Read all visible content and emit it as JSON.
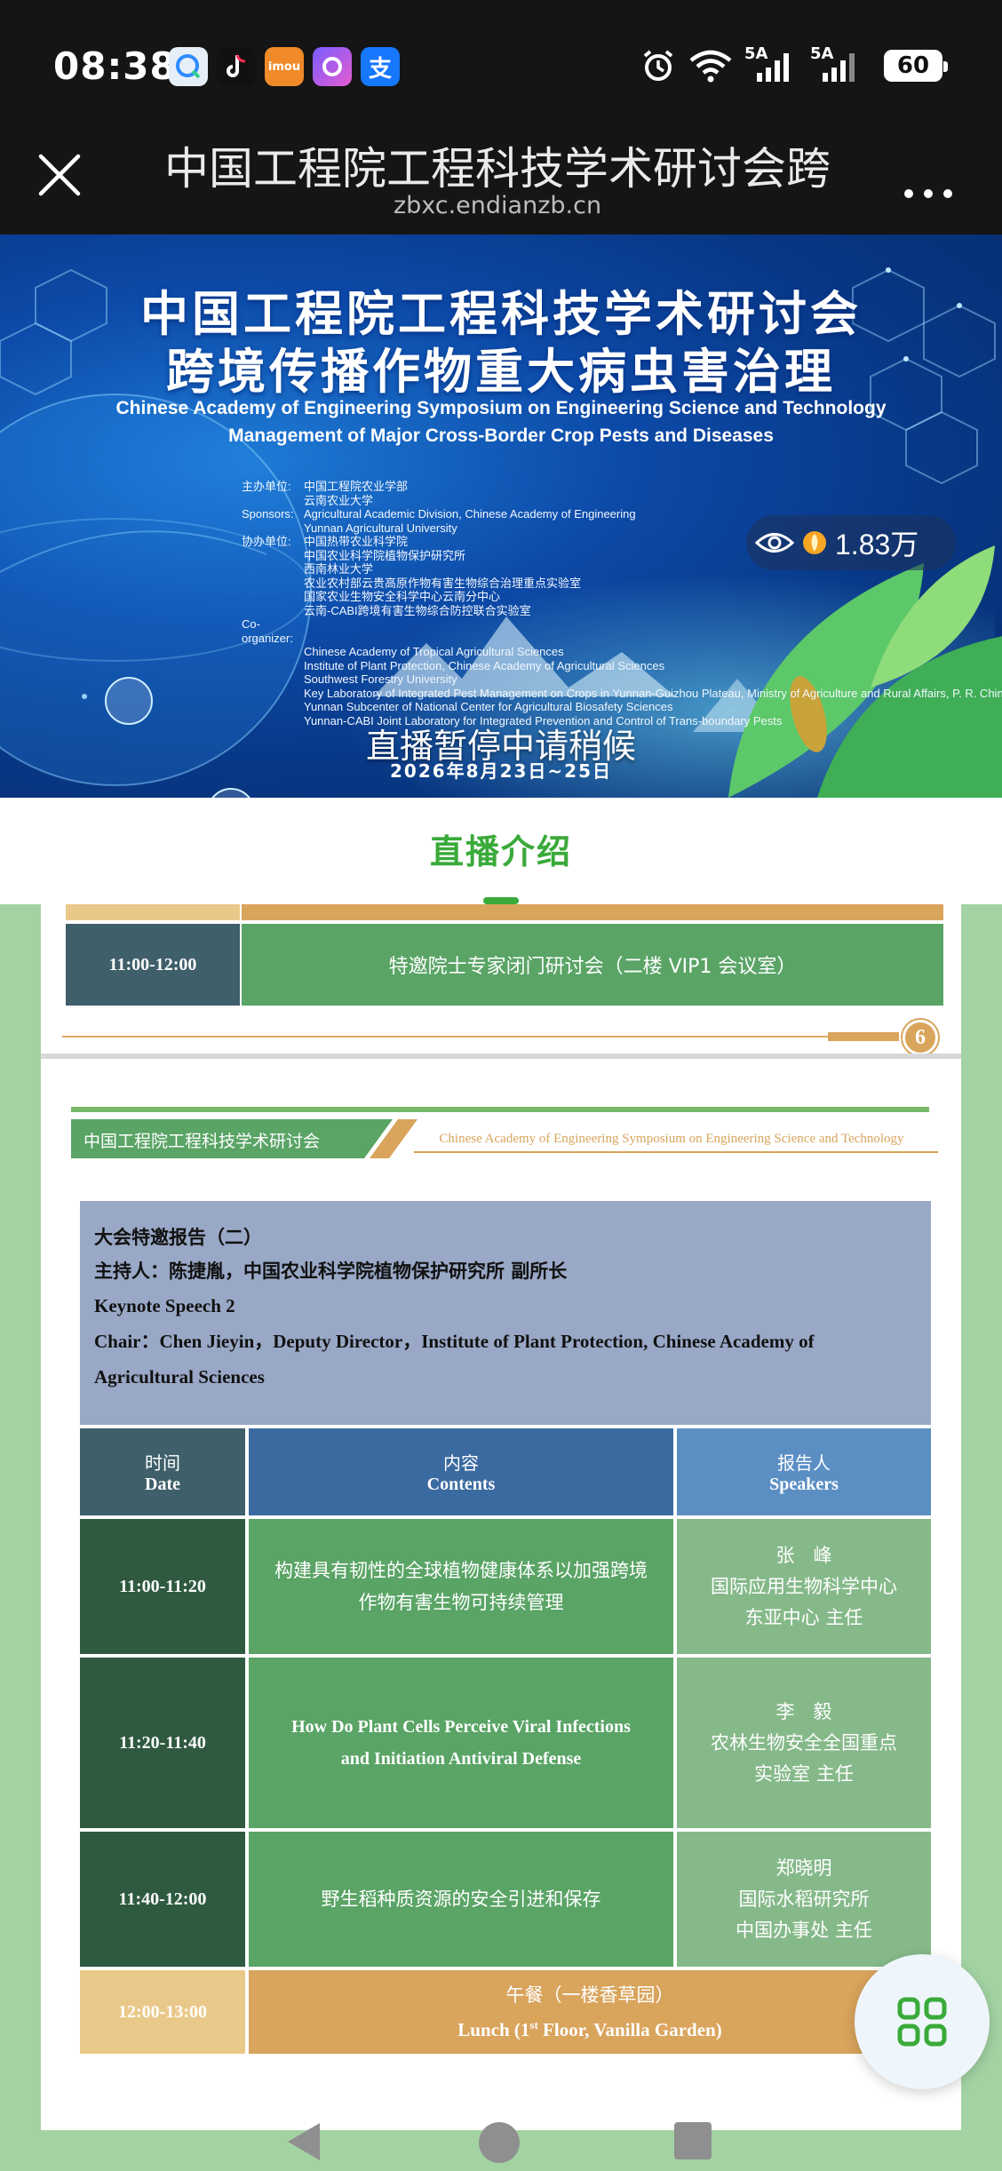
{
  "status_bar": {
    "time": "08:38",
    "app_icons": [
      {
        "name": "qq-browser-icon",
        "color": "#e6eef8"
      },
      {
        "name": "tiktok-icon",
        "color": "#111111"
      },
      {
        "name": "imou-icon",
        "label": "imou",
        "color": "#f08a2a"
      },
      {
        "name": "cloud-app-icon",
        "color": "#a96df0"
      },
      {
        "name": "alipay-icon",
        "label": "支",
        "color": "#1677ff"
      }
    ],
    "signal_1": "5A",
    "signal_2": "5A",
    "battery": "60"
  },
  "title_bar": {
    "title": "中国工程院工程科技学术研讨会跨",
    "domain": "zbxc.endianzb.cn"
  },
  "banner": {
    "title_line1": "中国工程院工程科技学术研讨会",
    "title_line2": "跨境传播作物重大病虫害治理",
    "subtitle_en_1": "Chinese Academy of Engineering Symposium on Engineering Science and Technology",
    "subtitle_en_2": "Management of Major Cross-Border Crop Pests and Diseases",
    "organizers": [
      {
        "key": "主办单位:",
        "value": "中国工程院农业学部"
      },
      {
        "key": "",
        "value": "云南农业大学"
      },
      {
        "key": "Sponsors:",
        "value": "Agricultural Academic Division, Chinese Academy of Engineering"
      },
      {
        "key": "",
        "value": "Yunnan Agricultural University"
      },
      {
        "key": "协办单位:",
        "value": "中国热带农业科学院"
      },
      {
        "key": "",
        "value": "中国农业科学院植物保护研究所"
      },
      {
        "key": "",
        "value": "西南林业大学"
      },
      {
        "key": "",
        "value": "农业农村部云贵高原作物有害生物综合治理重点实验室"
      },
      {
        "key": "",
        "value": "国家农业生物安全科学中心云南分中心"
      },
      {
        "key": "",
        "value": "云南-CABI跨境有害生物综合防控联合实验室"
      },
      {
        "key": "Co-organizer:",
        "value": ""
      },
      {
        "key": "",
        "value": "Chinese Academy of Tropical Agricultural Sciences"
      },
      {
        "key": "",
        "value": "Institute of Plant Protection, Chinese Academy of Agricultural Sciences"
      },
      {
        "key": "",
        "value": "Southwest Forestry University"
      },
      {
        "key": "",
        "value": "Key Laboratory of Integrated Pest Management on Crops in Yunnan-Guizhou Plateau, Ministry of Agriculture and Rural Affairs, P. R. China"
      },
      {
        "key": "",
        "value": "Yunnan Subcenter of National Center for Agricultural Biosafety Sciences"
      },
      {
        "key": "",
        "value": "Yunnan-CABI Joint Laboratory for Integrated Prevention and Control of Trans-boundary Pests"
      }
    ],
    "live_status": "直播暂停中请稍候",
    "date": "2026年8月23日~25日",
    "viewer_count": "1.83万"
  },
  "section": {
    "title": "直播介绍"
  },
  "agenda_prev": {
    "time": "11:00-12:00",
    "event": "特邀院士专家闭门研讨会（二楼 VIP1 会议室）",
    "page_number": "6"
  },
  "agenda_page": {
    "header_cn": "中国工程院工程科技学术研讨会",
    "header_en": "Chinese Academy of Engineering Symposium on Engineering Science and Technology",
    "session_title_cn": "大会特邀报告（二）",
    "chair_cn": "主持人：陈捷胤，中国农业科学院植物保护研究所 副所长",
    "session_title_en": "Keynote Speech 2",
    "chair_en_1": "Chair：Chen Jieyin，Deputy Director，Institute of Plant Protection, Chinese Academy of",
    "chair_en_2": "Agricultural Sciences",
    "columns": [
      {
        "cn": "时间",
        "en": "Date"
      },
      {
        "cn": "内容",
        "en": "Contents"
      },
      {
        "cn": "报告人",
        "en": "Speakers"
      }
    ],
    "rows": [
      {
        "time": "11:00-11:20",
        "content_1": "构建具有韧性的全球植物健康体系以加强跨境",
        "content_2": "作物有害生物可持续管理",
        "speaker_1": "张　峰",
        "speaker_2": "国际应用生物科学中心",
        "speaker_3": "东亚中心 主任"
      },
      {
        "time": "11:20-11:40",
        "content_1": "How Do Plant Cells Perceive Viral Infections",
        "content_2": "and Initiation Antiviral Defense",
        "speaker_1": "李　毅",
        "speaker_2": "农林生物安全全国重点",
        "speaker_3": "实验室 主任"
      },
      {
        "time": "11:40-12:00",
        "content_1": "野生稻种质资源的安全引进和保存",
        "content_2": "",
        "speaker_1": "郑晓明",
        "speaker_2": "国际水稻研究所",
        "speaker_3": "中国办事处 主任"
      }
    ],
    "lunch": {
      "time": "12:00-13:00",
      "label_cn": "午餐（一楼香草园）",
      "label_en_pre": "Lunch (1",
      "label_en_sup": "st",
      "label_en_post": " Floor, Vanilla Garden)"
    }
  },
  "colors": {
    "green_accent": "#3aaa3a",
    "dark_teal": "#3f5f6a",
    "row_dark": "#2f5a40",
    "row_mid": "#5aa466",
    "row_light": "#86b98a",
    "header_blue": "#3b6aa0",
    "header_lightblue": "#5b8fc4",
    "session_bg": "#99a8c6",
    "lunch_orange": "#d9a45c",
    "lunch_light": "#e9c98a"
  }
}
